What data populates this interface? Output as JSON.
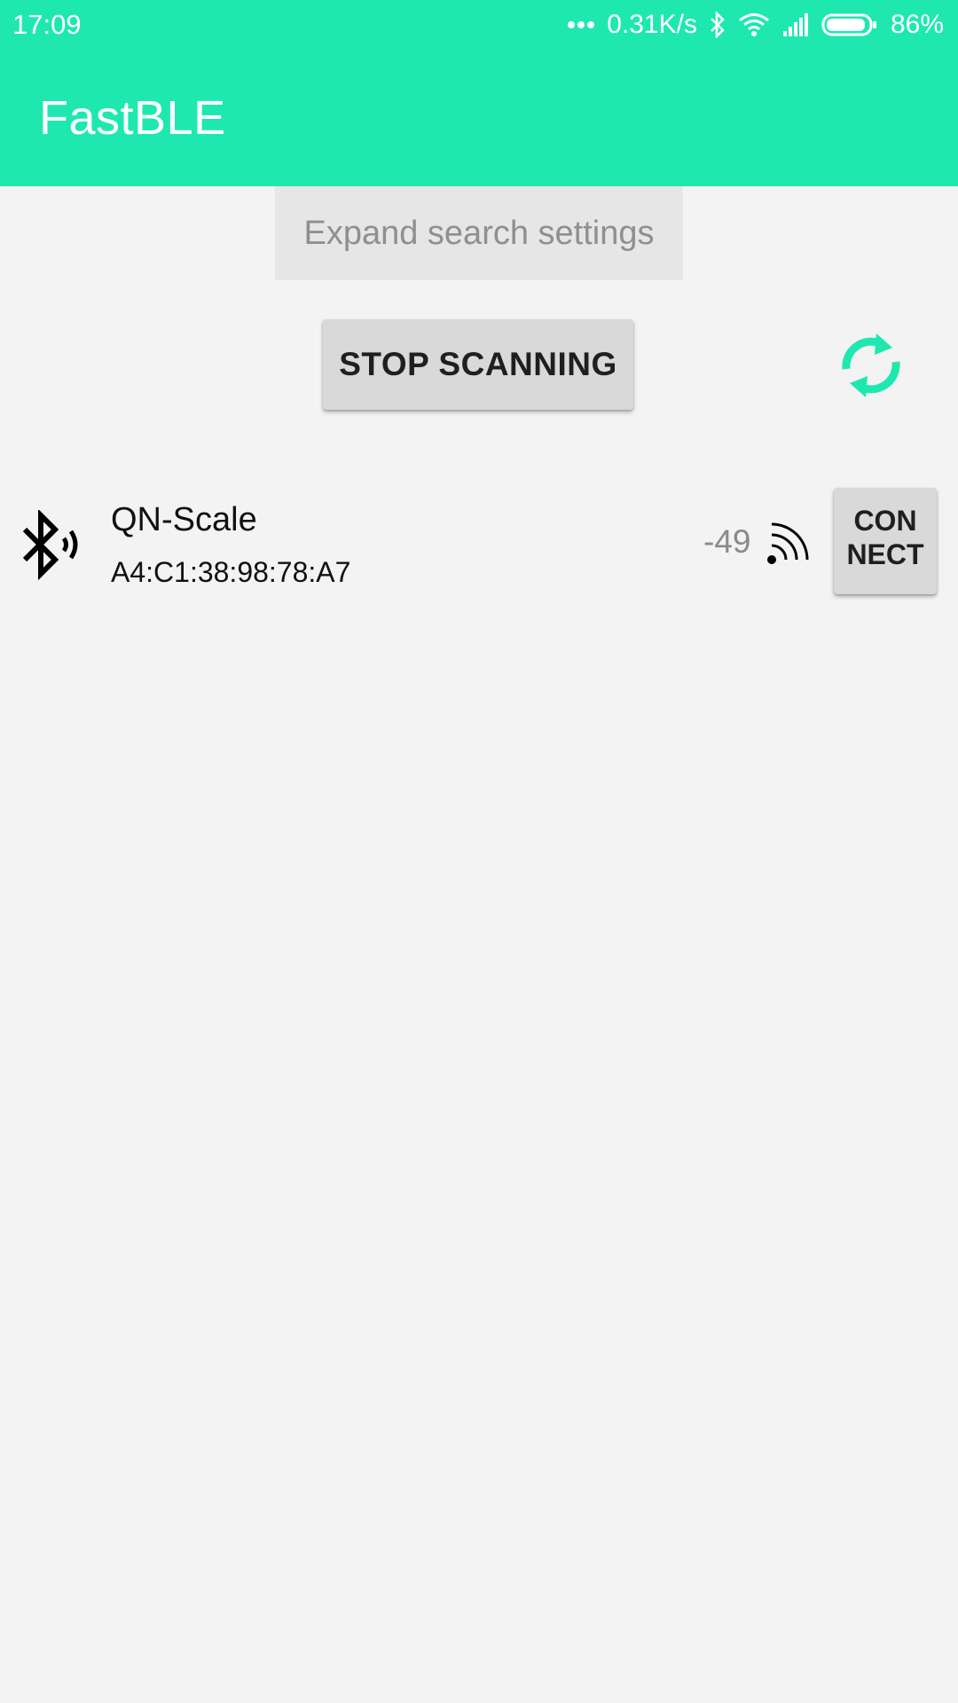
{
  "status_bar": {
    "time": "17:09",
    "speed": "0.31K/s",
    "battery": "86%"
  },
  "app": {
    "title": "FastBLE",
    "accent_color": "#1ee8b0"
  },
  "controls": {
    "expand_label": "Expand search settings",
    "stop_label": "STOP SCANNING"
  },
  "devices": [
    {
      "name": "QN-Scale",
      "mac": "A4:C1:38:98:78:A7",
      "rssi": "-49",
      "connect_label": "CONNECT"
    }
  ],
  "icons": {
    "refresh": "refresh-icon",
    "bluetooth": "bluetooth-icon",
    "signal": "signal-icon"
  }
}
